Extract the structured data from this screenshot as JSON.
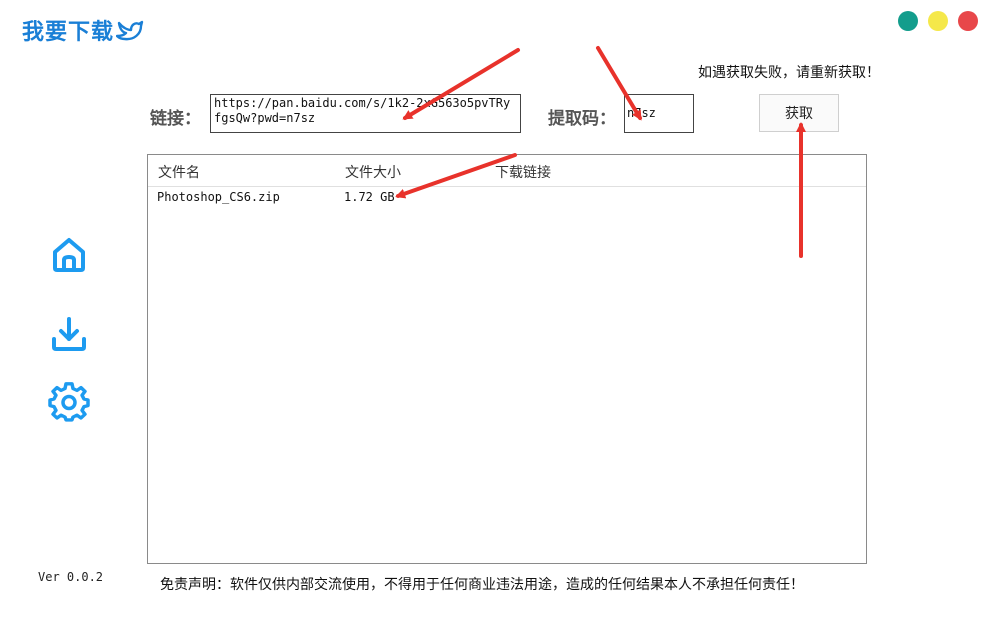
{
  "app": {
    "title": "我要下载",
    "version": "Ver 0.0.2",
    "window_controls": [
      {
        "name": "green-control",
        "color": "#139d8c"
      },
      {
        "name": "yellow-control",
        "color": "#f5e84a"
      },
      {
        "name": "red-control",
        "color": "#e8474a"
      }
    ]
  },
  "form": {
    "notice": "如遇获取失败，请重新获取！",
    "link_label": "链接：",
    "link_value": "https://pan.baidu.com/s/1k2-2xG563o5pvTRyfgsQw?pwd=n7sz",
    "code_label": "提取码：",
    "code_value": "n7sz",
    "fetch_label": "获取"
  },
  "table": {
    "headers": [
      "文件名",
      "文件大小",
      "下载链接"
    ],
    "rows": [
      {
        "name": "Photoshop_CS6.zip",
        "size": "1.72 GB",
        "link": ""
      }
    ]
  },
  "nav": [
    {
      "name": "home-icon"
    },
    {
      "name": "download-icon"
    },
    {
      "name": "settings-icon"
    }
  ],
  "footer": {
    "disclaimer": "免责声明：软件仅供内部交流使用，不得用于任何商业违法用途，造成的任何结果本人不承担任何责任！"
  },
  "colors": {
    "accent": "#1a7fd6",
    "icon": "#1d9bf0",
    "annotation_arrow": "#e8322b"
  }
}
